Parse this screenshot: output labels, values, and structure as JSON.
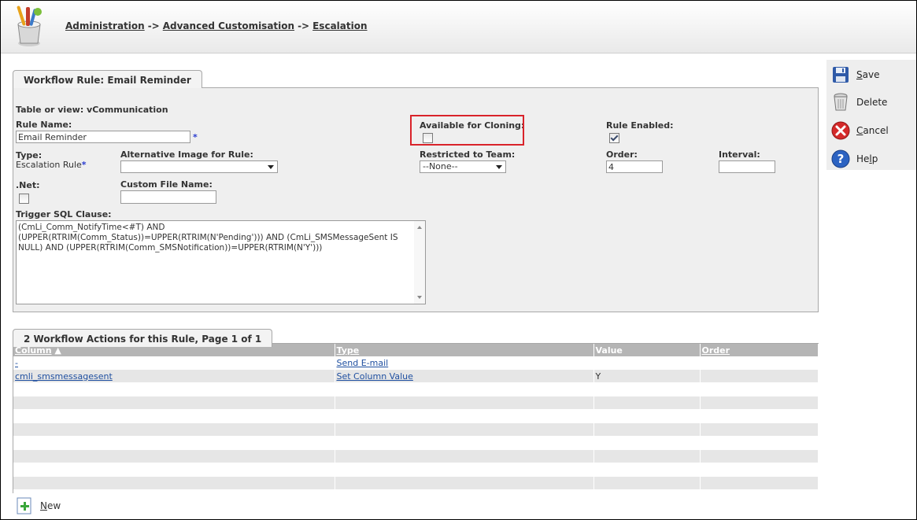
{
  "breadcrumb": {
    "items": [
      "Administration",
      "Advanced Customisation",
      "Escalation"
    ],
    "separator": "->"
  },
  "actions": {
    "save": {
      "access_key": "S",
      "rest": "ave"
    },
    "delete": {
      "label": "Delete"
    },
    "cancel": {
      "access_key": "C",
      "rest": "ancel"
    },
    "help": {
      "text_a": "He",
      "access_key": "l",
      "text_b": "p"
    }
  },
  "rule_panel": {
    "tab_title": "Workflow Rule: Email Reminder",
    "table_or_view": "Table or view: vCommunication",
    "rule_name": {
      "label": "Rule Name:",
      "value": "Email Reminder",
      "required_mark": "*"
    },
    "available_for_cloning": {
      "label": "Available for Cloning:",
      "checked": false
    },
    "rule_enabled": {
      "label": "Rule Enabled:",
      "checked": true
    },
    "type": {
      "label": "Type:",
      "value": "Escalation Rule",
      "required_mark": "*"
    },
    "alt_image": {
      "label": "Alternative Image for Rule:",
      "value": ""
    },
    "restricted_team": {
      "label": "Restricted to Team:",
      "value": "--None--"
    },
    "order": {
      "label": "Order:",
      "value": "4"
    },
    "interval": {
      "label": "Interval:",
      "value": ""
    },
    "dotnet": {
      "label": ".Net:",
      "checked": false
    },
    "custom_file": {
      "label": "Custom File Name:",
      "value": ""
    },
    "trigger_sql": {
      "label": "Trigger SQL Clause:",
      "value": "(CmLi_Comm_NotifyTime<#T) AND (UPPER(RTRIM(Comm_Status))=UPPER(RTRIM(N'Pending'))) AND (CmLi_SMSMessageSent IS NULL) AND (UPPER(RTRIM(Comm_SMSNotification))=UPPER(RTRIM(N'Y')))"
    }
  },
  "actions_panel": {
    "tab_title": "2 Workflow Actions for this Rule, Page 1 of 1",
    "columns": [
      "Column",
      "Type",
      "Value",
      "Order"
    ],
    "sort_indicator": "▲",
    "rows": [
      {
        "column": "-",
        "type": "Send E-mail",
        "value": "",
        "order": ""
      },
      {
        "column": "cmli_smsmessagesent",
        "type": "Set Column Value",
        "value": "Y",
        "order": ""
      }
    ],
    "empty_rows": 9
  },
  "new_button": {
    "access_key": "N",
    "rest": "ew"
  },
  "colors": {
    "highlight": "#d9232a",
    "link": "#1f4fa0",
    "header_bg": "#b5b5b5",
    "panel_bg": "#efefef"
  },
  "icons": [
    "toolbox-icon",
    "save-disk-icon",
    "trash-can-icon",
    "cancel-x-icon",
    "help-question-icon",
    "new-plus-icon"
  ]
}
